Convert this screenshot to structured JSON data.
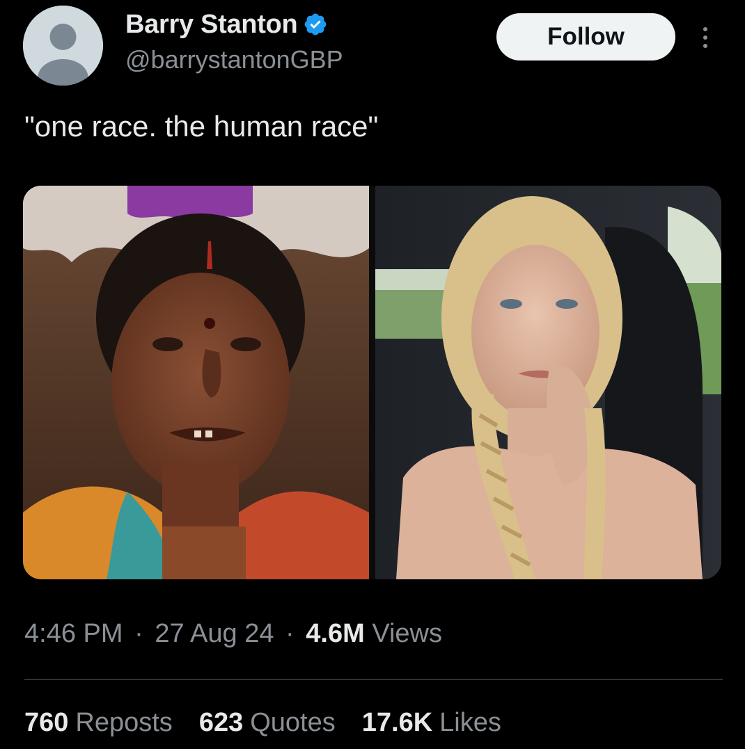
{
  "author": {
    "display_name": "Barry Stanton",
    "handle": "@barrystantonGBP",
    "verified": true,
    "verified_color": "#1d9bf0"
  },
  "actions": {
    "follow_label": "Follow"
  },
  "tweet": {
    "text": "\"one race. the human race\""
  },
  "media": {
    "photos": [
      {
        "icon": "portrait-photo-older-woman"
      },
      {
        "icon": "portrait-photo-blonde-woman-in-car"
      }
    ]
  },
  "meta": {
    "time": "4:46 PM",
    "separator": "·",
    "date": "27 Aug 24",
    "views_count": "4.6M",
    "views_label": "Views"
  },
  "stats": {
    "reposts_count": "760",
    "reposts_label": "Reposts",
    "quotes_count": "623",
    "quotes_label": "Quotes",
    "likes_count": "17.6K",
    "likes_label": "Likes"
  },
  "colors": {
    "background": "#000000",
    "primary_text": "#e7e9ea",
    "secondary_text": "#8b9096",
    "divider": "#2f3336",
    "follow_bg": "#eff3f4"
  }
}
